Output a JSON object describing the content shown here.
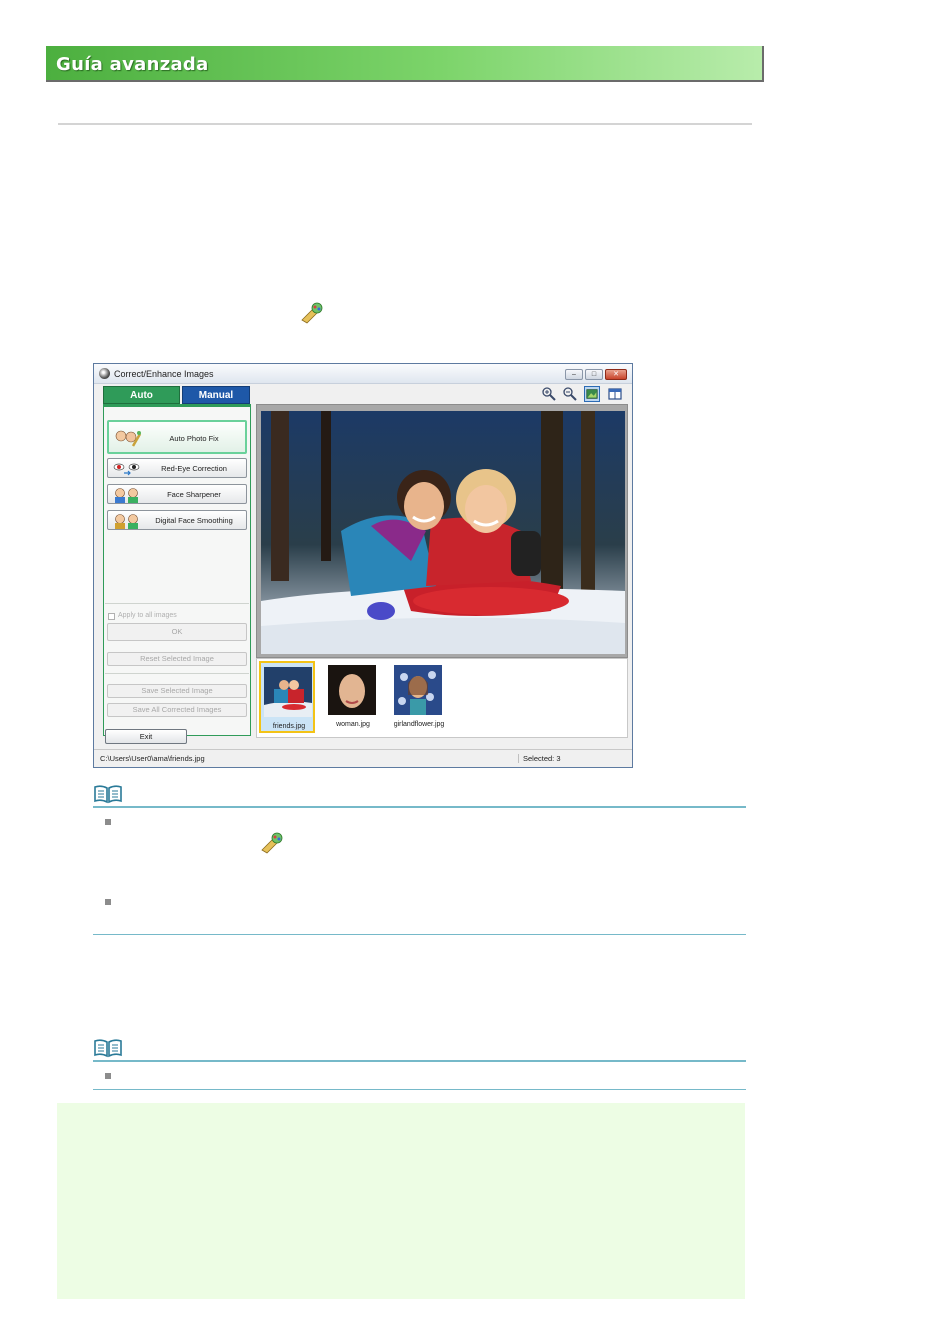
{
  "header": {
    "title": "Guía avanzada"
  },
  "window": {
    "title": "Correct/Enhance Images",
    "tabs": {
      "auto": "Auto",
      "manual": "Manual"
    },
    "functions": {
      "auto_photo_fix": "Auto Photo Fix",
      "red_eye": "Red-Eye Correction",
      "face_sharpener": "Face Sharpener",
      "face_smoothing": "Digital Face Smoothing"
    },
    "apply_all": "Apply to all images",
    "ok": "OK",
    "reset": "Reset Selected Image",
    "save_selected": "Save Selected Image",
    "save_all": "Save All Corrected Images",
    "exit": "Exit",
    "thumbnails": [
      "friends.jpg",
      "woman.jpg",
      "girlandflower.jpg"
    ],
    "status_path": "C:\\Users\\User0\\ama\\friends.jpg",
    "status_selected": "Selected: 3"
  },
  "colors": {
    "header_green": "#4caf3f",
    "note_rule": "#76b9c9",
    "tab_auto": "#2f9b59",
    "tab_manual": "#1e58a8",
    "footer_box": "#edfde4"
  }
}
